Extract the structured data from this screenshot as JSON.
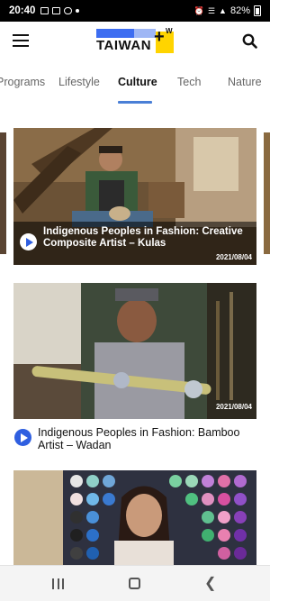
{
  "status_bar": {
    "time": "20:40",
    "battery": "82%"
  },
  "header": {
    "menu_icon": "hamburger-menu-icon",
    "logo_text": "TAIWAN",
    "logo_letter": "W",
    "search_icon": "search-icon"
  },
  "tabs": [
    {
      "label": "Programs",
      "active": false
    },
    {
      "label": "Lifestyle",
      "active": false
    },
    {
      "label": "Culture",
      "active": true
    },
    {
      "label": "Tech",
      "active": false
    },
    {
      "label": "Nature",
      "active": false
    }
  ],
  "feed": [
    {
      "title": "Indigenous Peoples in Fashion: Creative Composite Artist – Kulas",
      "date": "2021/08/04"
    },
    {
      "title": "Indigenous Peoples in Fashion: Bamboo Artist – Wadan",
      "date": "2021/08/04"
    },
    {
      "title": "",
      "date": ""
    }
  ],
  "colors": {
    "accent": "#4a7fd6",
    "play_blue": "#2f5fe0",
    "logo_blue": "#3d6df1",
    "logo_yellow": "#ffd400"
  },
  "nav_bar": {
    "recents_icon": "recents-icon",
    "home_icon": "home-icon",
    "back_icon": "back-chevron-icon"
  }
}
